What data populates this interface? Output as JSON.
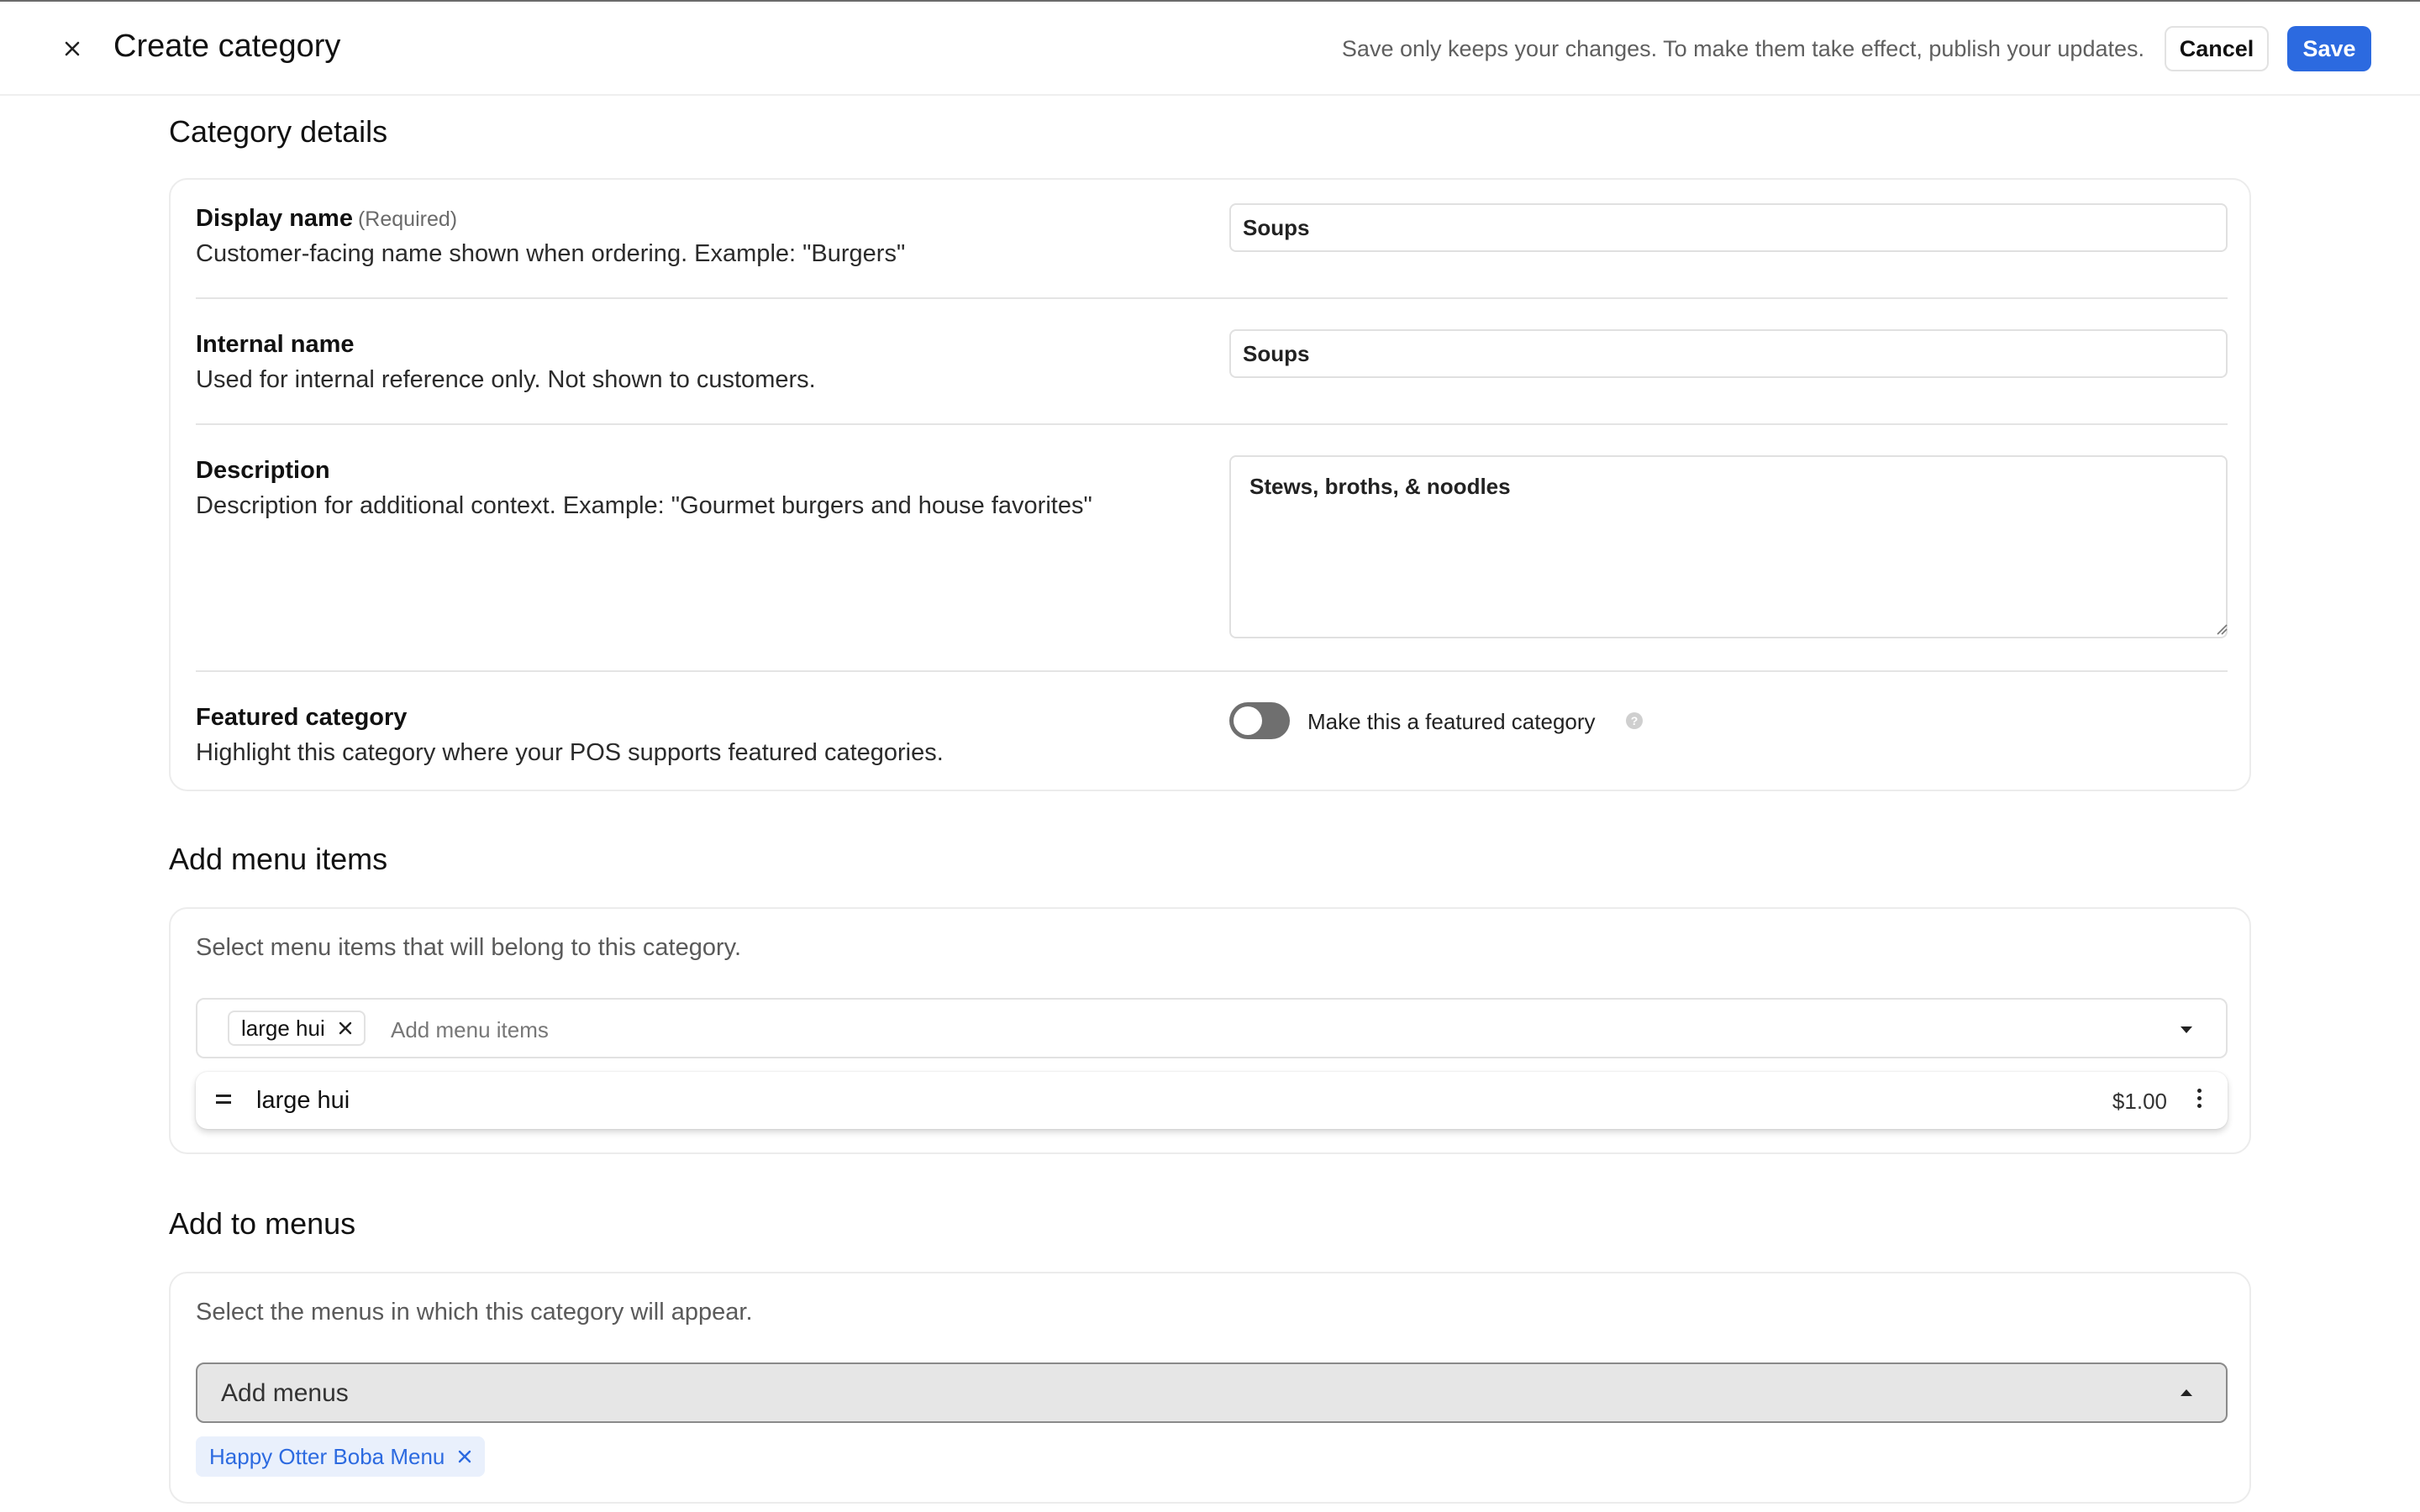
{
  "header": {
    "title": "Create category",
    "save_note": "Save only keeps your changes. To make them take effect, publish your updates.",
    "cancel_label": "Cancel",
    "save_label": "Save"
  },
  "category_details": {
    "title": "Category details",
    "display_name": {
      "label": "Display name",
      "required_tag": "(Required)",
      "description": "Customer-facing name shown when ordering. Example: \"Burgers\"",
      "value": "Soups"
    },
    "internal_name": {
      "label": "Internal name",
      "description": "Used for internal reference only. Not shown to customers.",
      "value": "Soups"
    },
    "description": {
      "label": "Description",
      "description": "Description for additional context. Example: \"Gourmet burgers and house favorites\"",
      "value": "Stews, broths, & noodles"
    },
    "featured": {
      "label": "Featured category",
      "description": "Highlight this category where your POS supports featured categories.",
      "toggle_label": "Make this a featured category",
      "toggle_on": false,
      "help_glyph": "?"
    }
  },
  "menu_items": {
    "title": "Add menu items",
    "description": "Select menu items that will belong to this category.",
    "placeholder": "Add menu items",
    "chips": [
      "large hui"
    ],
    "items": [
      {
        "name": "large hui",
        "price": "$1.00"
      }
    ]
  },
  "menus": {
    "title": "Add to menus",
    "description": "Select the menus in which this category will appear.",
    "select_label": "Add menus",
    "chips": [
      "Happy Otter Boba Menu"
    ]
  },
  "colors": {
    "accent": "#2c6ae0",
    "toggle_off": "#6f6f6f",
    "chip_bg": "#e9f0fc"
  },
  "icons": {
    "close": "close-icon",
    "drag": "drag-handle-icon",
    "more": "more-vertical-icon",
    "remove": "remove-icon",
    "caret_down": "chevron-down-icon",
    "caret_up": "chevron-up-icon",
    "help": "help-icon"
  }
}
